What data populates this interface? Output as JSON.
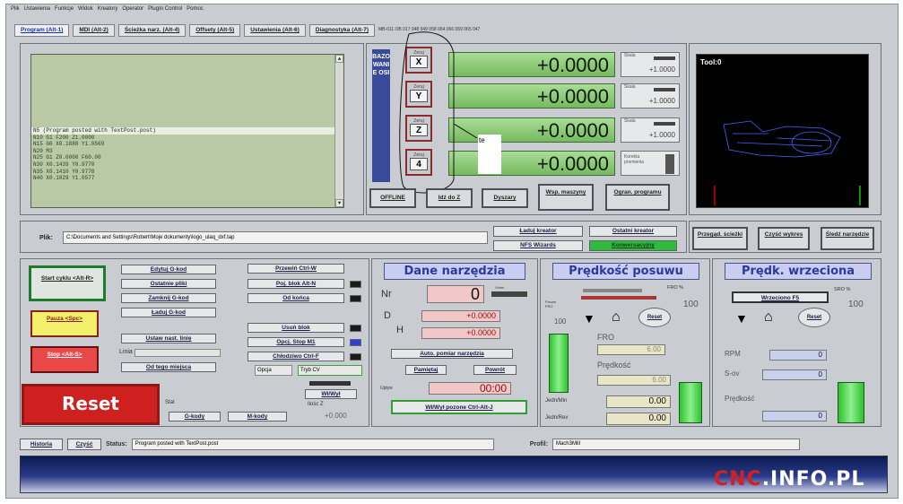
{
  "menu": [
    "Plik",
    "Ustawienia",
    "Funkcje",
    "Widok",
    "Kreatory",
    "Operator",
    "PlugIn Control",
    "Pomoc"
  ],
  "tabs": [
    {
      "label": "Program (Alt-1)",
      "active": true
    },
    {
      "label": "MDI (Alt-2)",
      "active": false
    },
    {
      "label": "Ścieżka narz. (Alt-4)",
      "active": false
    },
    {
      "label": "Offsety (Alt-5)",
      "active": false
    },
    {
      "label": "Ustawienia (Alt-6)",
      "active": false
    },
    {
      "label": "Diagnostyka (Alt-7)",
      "active": false
    }
  ],
  "tab_strip_text": "MB-011 OB 017 048 049 058 064 066 069 065 047",
  "gcode_lines": [
    {
      "text": "N5 (Program posted with TextPost.post)",
      "highlight": true
    },
    {
      "text": "N10 G1 F200  Z1.0000",
      "highlight": false
    },
    {
      "text": "N15 G0  X0.1888  Y1.0569",
      "highlight": false
    },
    {
      "text": "N20 M3",
      "highlight": false
    },
    {
      "text": "N25 G1  Z0.0000  F60.00",
      "highlight": false
    },
    {
      "text": "N30  X0.1439  Y0.9770",
      "highlight": false
    },
    {
      "text": "N35  X0.1410  Y0.9778",
      "highlight": false
    },
    {
      "text": "N40  X0.1029  Y1.0577",
      "highlight": false
    }
  ],
  "referencing_label": "BAZOWANIE OSI",
  "axes": [
    {
      "zero_label": "Zeruj",
      "axis": "X",
      "value": "+0.0000",
      "scale_label": "Skala",
      "scale": "+1.0000"
    },
    {
      "zero_label": "Zeruj",
      "axis": "Y",
      "value": "+0.0000",
      "scale_label": "Skala",
      "scale": "+1.0000"
    },
    {
      "zero_label": "Zeruj",
      "axis": "Z",
      "value": "+0.0000",
      "scale_label": "Skala",
      "scale": "+1.0000"
    },
    {
      "zero_label": "Zeruj",
      "axis": "4",
      "value": "+0.0000",
      "scale_label": "Korekta promienia",
      "scale": ""
    }
  ],
  "annotation_text": "te",
  "dro_buttons": [
    "OFFLINE",
    "Idź do Z",
    "Dyszary",
    "Wsp. maszyny",
    "Ogran. programu"
  ],
  "toolpath": {
    "title": "Tool:0"
  },
  "file": {
    "label": "Plik:",
    "path": "C:\\Documents and Settings\\Robert\\Moje dokumenty\\logo_ulaq_dxf.tap"
  },
  "file_buttons": {
    "load_wizard": "Ładuj kreator",
    "last_wizard": "Ostatni kreator",
    "nfs_wizards": "NFS Wizards",
    "conversational": "Konwersacyjny"
  },
  "view_buttons": [
    "Przegąd. ścieżki",
    "Czyść wykres",
    "Śledź narzędzie"
  ],
  "cycle": {
    "start": "Start cyklu <Alt-R>",
    "pause": "Pauza <Spc>",
    "stop": "Stop <Alt-S>"
  },
  "prog_buttons_left": [
    "Edytuj G-kod",
    "Ostatnie pliki",
    "Zamknij G-kod",
    "Ładuj G-kod",
    "Ustaw nast. linię",
    "Od tego miejsca"
  ],
  "line_label": "Linia",
  "prog_buttons_right": [
    "Przewiń Ctrl-W",
    "Poj. blok Alt-N",
    "Od końca",
    "Usuń blok",
    "Opcj. Stop M1",
    "Chłodziwo Ctrl-F"
  ],
  "opcj_label": "Opcja",
  "tryb_label": "Tryb CV",
  "reset": {
    "label": "Reset",
    "elapsed_label": "Stat"
  },
  "gcode_buttons": [
    "G-kody",
    "M-kody"
  ],
  "vu": {
    "label": "Wł/Wył",
    "blade_label": "Ilośc Z",
    "value": "+0.000"
  },
  "tool": {
    "header": "Dane narzędzia",
    "nr_label": "Nr",
    "nr": "0",
    "nr_side": "Video",
    "d_label": "D",
    "d": "+0.0000",
    "h_label": "H",
    "h": "+0.0000",
    "auto_button": "Auto. pomiar narzędzia",
    "remember_button": "Pamiętaj",
    "return_button": "Powrót",
    "time_label": "Upływ",
    "time": "00:00",
    "toggle_button": "Wł/Wył pozone Ctrl-Alt-J"
  },
  "feed": {
    "header": "Prędkość posuwu",
    "fro_label": "FRO %",
    "fro_pct": "100",
    "side_label": "Posuw FRO",
    "side_value": "100",
    "reset": "Reset",
    "fro_text": "FRO",
    "fro_value": "6.00",
    "feed_label": "Prędkość",
    "feed_value": "6.00",
    "units_min_label": "Jedn/Min",
    "units_min": "0.00",
    "units_rev_label": "Jedn/Rev",
    "units_rev": "0.00",
    "level": 0.85
  },
  "spindle": {
    "header": "Prędk. wrzeciona",
    "toggle": "Wrzeciono F5",
    "sro_label": "SRO %",
    "sro_value": "100",
    "reset": "Reset",
    "rpm_label": "RPM",
    "rpm": "0",
    "sov_label": "S-ov",
    "sov": "0",
    "speed_label": "Prędkość",
    "speed": "0",
    "level": 0.85
  },
  "status_bar": {
    "history": "Historia",
    "clear": "Czyść",
    "status_label": "Status:",
    "status": "Program posted with TextPost.post",
    "profile_label": "Profil:",
    "profile": "Mach3Mill"
  },
  "watermark": "CNC.INFO.PL"
}
